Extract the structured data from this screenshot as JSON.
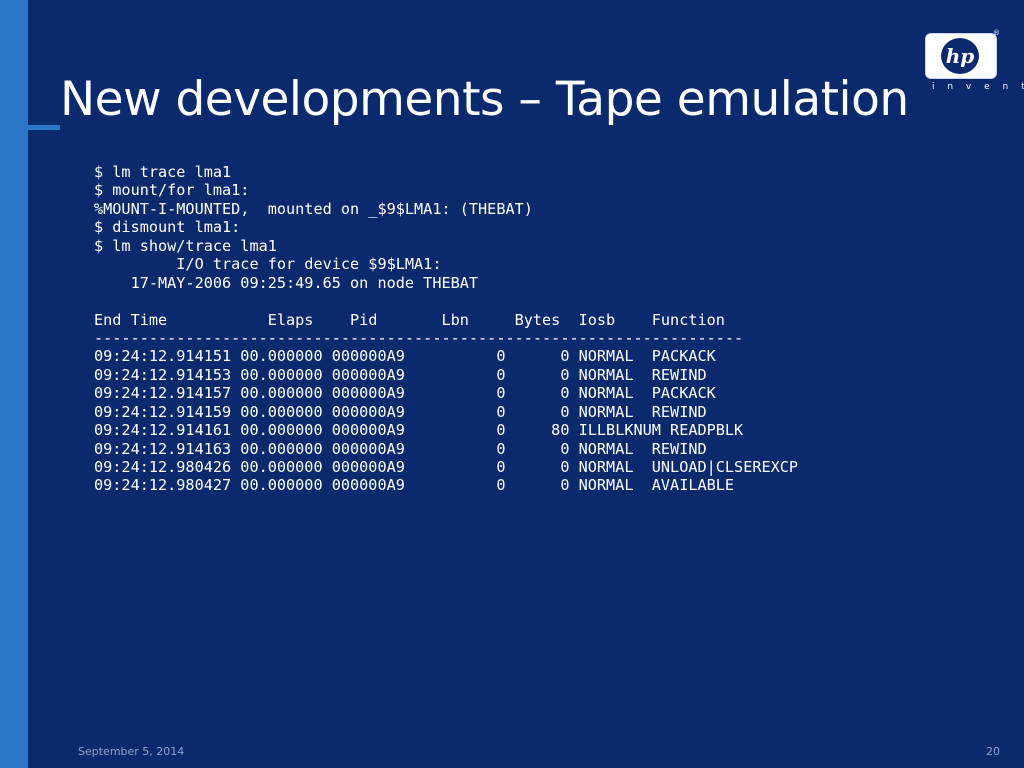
{
  "slide": {
    "title": "New developments – Tape emulation",
    "logo": {
      "icon": "hp-logo-icon",
      "wordmark": "hp",
      "tagline": "i n v e n t",
      "registered": "®"
    },
    "terminal_lines": [
      "$ lm trace lma1",
      "$ mount/for lma1:",
      "%MOUNT-I-MOUNTED,  mounted on _$9$LMA1: (THEBAT)",
      "$ dismount lma1:",
      "$ lm show/trace lma1",
      "         I/O trace for device $9$LMA1:",
      "    17-MAY-2006 09:25:49.65 on node THEBAT",
      "",
      "End Time           Elaps    Pid       Lbn     Bytes  Iosb    Function",
      "-----------------------------------------------------------------------",
      "09:24:12.914151 00.000000 000000A9          0      0 NORMAL  PACKACK",
      "09:24:12.914153 00.000000 000000A9          0      0 NORMAL  REWIND",
      "09:24:12.914157 00.000000 000000A9          0      0 NORMAL  PACKACK",
      "09:24:12.914159 00.000000 000000A9          0      0 NORMAL  REWIND",
      "09:24:12.914161 00.000000 000000A9          0     80 ILLBLKNUM READPBLK",
      "09:24:12.914163 00.000000 000000A9          0      0 NORMAL  REWIND",
      "09:24:12.980426 00.000000 000000A9          0      0 NORMAL  UNLOAD|CLSEREXCP",
      "09:24:12.980427 00.000000 000000A9          0      0 NORMAL  AVAILABLE"
    ],
    "footer": {
      "date": "September 5, 2014",
      "page_number": "20"
    },
    "colors": {
      "background": "#0b2a6e",
      "left_bar": "#2a76c8",
      "text": "#ffffff",
      "footer_text": "#8fa3c9"
    }
  }
}
